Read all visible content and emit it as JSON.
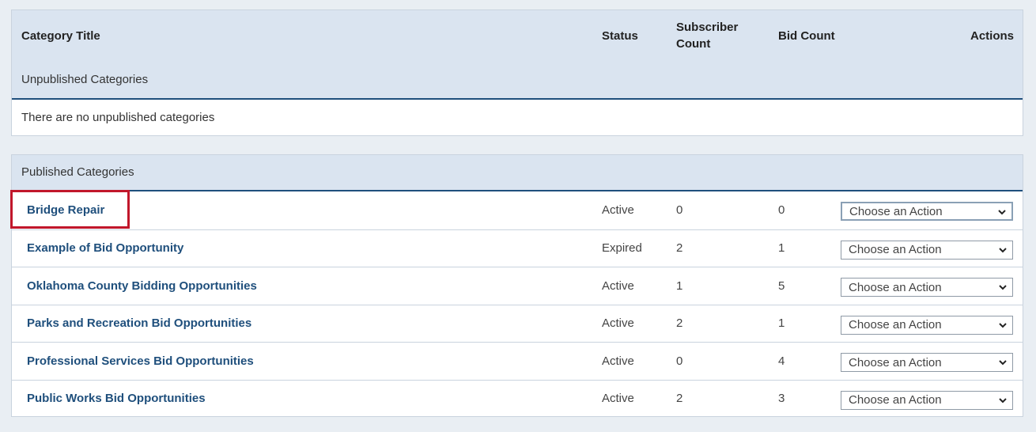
{
  "columns": {
    "title": "Category Title",
    "status": "Status",
    "subscriber_count_line1": "Subscriber",
    "subscriber_count_line2": "Count",
    "bid_count": "Bid Count",
    "actions": "Actions"
  },
  "unpublished": {
    "heading": "Unpublished Categories",
    "empty_message": "There are no unpublished categories"
  },
  "published": {
    "heading": "Published Categories",
    "rows": [
      {
        "title": "Bridge Repair",
        "status": "Active",
        "subscribers": "0",
        "bids": "0",
        "action": "Choose an Action"
      },
      {
        "title": "Example of Bid Opportunity",
        "status": "Expired",
        "subscribers": "2",
        "bids": "1",
        "action": "Choose an Action"
      },
      {
        "title": "Oklahoma County Bidding Opportunities",
        "status": "Active",
        "subscribers": "1",
        "bids": "5",
        "action": "Choose an Action"
      },
      {
        "title": "Parks and Recreation Bid Opportunities",
        "status": "Active",
        "subscribers": "2",
        "bids": "1",
        "action": "Choose an Action"
      },
      {
        "title": "Professional Services Bid Opportunities",
        "status": "Active",
        "subscribers": "0",
        "bids": "4",
        "action": "Choose an Action"
      },
      {
        "title": "Public Works Bid Opportunities",
        "status": "Active",
        "subscribers": "2",
        "bids": "3",
        "action": "Choose an Action"
      }
    ]
  },
  "colors": {
    "header_bg": "#dae4f0",
    "link": "#1f4f7c",
    "highlight": "#c1172b"
  }
}
